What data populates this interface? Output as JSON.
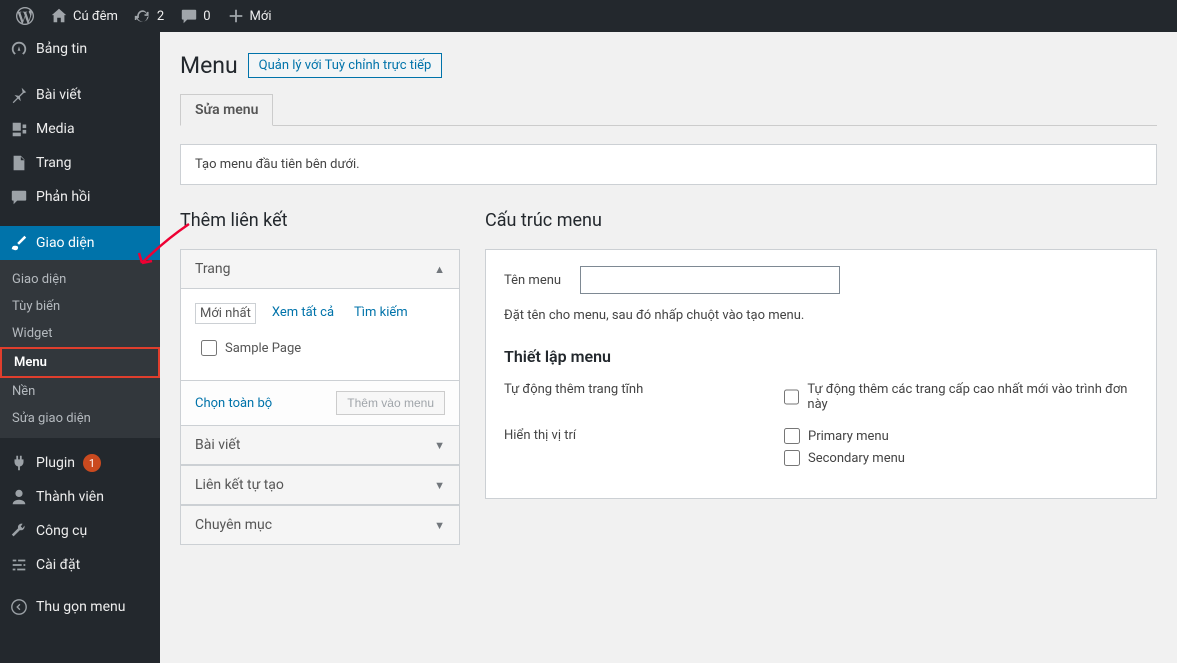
{
  "adminbar": {
    "site_name": "Cú đêm",
    "updates_count": "2",
    "comments_count": "0",
    "new_label": "Mới"
  },
  "sidebar": {
    "items": [
      {
        "label": "Bảng tin"
      },
      {
        "label": "Bài viết"
      },
      {
        "label": "Media"
      },
      {
        "label": "Trang"
      },
      {
        "label": "Phản hồi"
      },
      {
        "label": "Giao diện"
      },
      {
        "label": "Plugin",
        "badge": "1"
      },
      {
        "label": "Thành viên"
      },
      {
        "label": "Công cụ"
      },
      {
        "label": "Cài đặt"
      },
      {
        "label": "Thu gọn menu"
      }
    ],
    "submenu": [
      {
        "label": "Giao diện"
      },
      {
        "label": "Tùy biến"
      },
      {
        "label": "Widget"
      },
      {
        "label": "Menu"
      },
      {
        "label": "Nền"
      },
      {
        "label": "Sửa giao diện"
      }
    ]
  },
  "page": {
    "title": "Menu",
    "title_action": "Quản lý với Tuỳ chỉnh trực tiếp",
    "tab": "Sửa menu",
    "notice": "Tạo menu đầu tiên bên dưới."
  },
  "left": {
    "heading": "Thêm liên kết",
    "acc_pages": "Trang",
    "link_tabs": {
      "recent": "Mới nhất",
      "all": "Xem tất cả",
      "search": "Tìm kiếm"
    },
    "sample_page": "Sample Page",
    "select_all": "Chọn toàn bộ",
    "add_btn": "Thêm vào menu",
    "acc_posts": "Bài viết",
    "acc_custom": "Liên kết tự tạo",
    "acc_cats": "Chuyên mục"
  },
  "right": {
    "heading": "Cấu trúc menu",
    "name_label": "Tên menu",
    "name_value": "",
    "help": "Đặt tên cho menu, sau đó nhấp chuột vào tạo menu.",
    "settings_title": "Thiết lập menu",
    "auto_add_label": "Tự động thêm trang tĩnh",
    "auto_add_opt": "Tự động thêm các trang cấp cao nhất mới vào trình đơn này",
    "location_label": "Hiển thị vị trí",
    "loc1": "Primary menu",
    "loc2": "Secondary menu"
  }
}
